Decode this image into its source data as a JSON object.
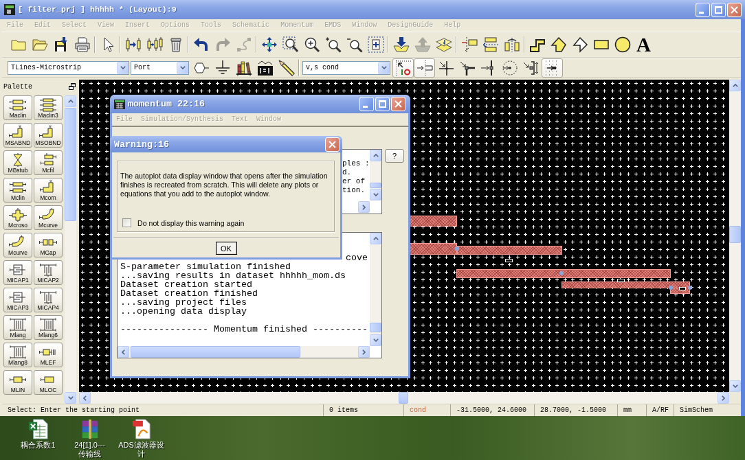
{
  "window": {
    "title": "[ filter_prj ] hhhhh * (Layout):9"
  },
  "menu": {
    "disabled": true,
    "items": [
      "File",
      "Edit",
      "Select",
      "View",
      "Insert",
      "Options",
      "Tools",
      "Schematic",
      "Momentum",
      "EMDS",
      "Window",
      "DesignGuide",
      "Help"
    ]
  },
  "main_toolbar": {
    "groups": [
      [
        {
          "kind": "new",
          "disabled": false
        },
        {
          "kind": "open",
          "disabled": false
        },
        {
          "kind": "save",
          "disabled": false
        },
        {
          "kind": "print",
          "disabled": false
        }
      ],
      [
        {
          "kind": "pointer",
          "disabled": false
        }
      ],
      [
        {
          "kind": "pinsright",
          "disabled": false
        },
        {
          "kind": "pinsleft",
          "disabled": false
        },
        {
          "kind": "trash",
          "disabled": false
        }
      ],
      [
        {
          "kind": "undo",
          "disabled": false
        },
        {
          "kind": "redo",
          "disabled": true
        },
        {
          "kind": "route",
          "disabled": true
        }
      ],
      [
        {
          "kind": "move",
          "disabled": false
        },
        {
          "kind": "zoomarea",
          "disabled": false
        },
        {
          "kind": "zoom",
          "disabled": false
        },
        {
          "kind": "zoomin",
          "disabled": false
        },
        {
          "kind": "zoomout",
          "disabled": false
        },
        {
          "kind": "fit",
          "disabled": false
        }
      ],
      [
        {
          "kind": "download",
          "disabled": false
        },
        {
          "kind": "upload",
          "disabled": true
        },
        {
          "kind": "layers",
          "disabled": false
        }
      ],
      [
        {
          "kind": "align",
          "disabled": false
        },
        {
          "kind": "mirror",
          "disabled": false
        },
        {
          "kind": "rotate",
          "disabled": false
        }
      ],
      [
        {
          "kind": "polyline",
          "disabled": false
        },
        {
          "kind": "polygon",
          "disabled": false
        },
        {
          "kind": "outline",
          "disabled": false
        },
        {
          "kind": "rectangle",
          "disabled": false
        },
        {
          "kind": "circle",
          "disabled": false
        },
        {
          "kind": "text",
          "disabled": false,
          "glyph": "A"
        }
      ]
    ]
  },
  "place_toolbar": {
    "library": "TLines-Microstrip",
    "component": "Port",
    "tools": [
      {
        "kind": "port"
      },
      {
        "kind": "ground"
      },
      {
        "kind": "library"
      },
      {
        "kind": "equation"
      },
      {
        "kind": "wire"
      }
    ],
    "layer": "v,s cond",
    "snap_modes": [
      {
        "kind": "gridsnap",
        "on": true
      },
      {
        "kind": "pinsnap",
        "on": true
      },
      {
        "kind": "intersection",
        "on": false
      },
      {
        "kind": "corner",
        "on": false
      },
      {
        "kind": "edge",
        "on": false
      },
      {
        "kind": "arc",
        "on": false
      },
      {
        "kind": "midpoint",
        "on": false
      },
      {
        "kind": "dotgrid",
        "on": true
      }
    ]
  },
  "palette": {
    "title": "Palette",
    "items": [
      {
        "label": "Maclin",
        "kind": "coupled"
      },
      {
        "label": "Maclin3",
        "kind": "coupled3"
      },
      {
        "label": "MSABND",
        "kind": "bend"
      },
      {
        "label": "MSOBND",
        "kind": "bend"
      },
      {
        "label": "MBstub",
        "kind": "bowtie"
      },
      {
        "label": "Mcfil",
        "kind": "offset"
      },
      {
        "label": "Mclin",
        "kind": "coupled"
      },
      {
        "label": "Mcorn",
        "kind": "corner"
      },
      {
        "label": "Mcroso",
        "kind": "cross"
      },
      {
        "label": "Mcurve",
        "kind": "curve"
      },
      {
        "label": "Mcurve",
        "kind": "curve"
      },
      {
        "label": "MGap",
        "kind": "gap"
      },
      {
        "label": "MICAP1",
        "kind": "fingers"
      },
      {
        "label": "MICAP2",
        "kind": "comb"
      },
      {
        "label": "MICAP3",
        "kind": "fingers"
      },
      {
        "label": "MICAP4",
        "kind": "comb"
      },
      {
        "label": "Mlang",
        "kind": "lange"
      },
      {
        "label": "Mlang6",
        "kind": "lange"
      },
      {
        "label": "Mlang8",
        "kind": "lange"
      },
      {
        "label": "MLEF",
        "kind": "lineend"
      },
      {
        "label": "MLIN",
        "kind": "line"
      },
      {
        "label": "MLOC",
        "kind": "open"
      }
    ]
  },
  "momentum_window": {
    "title": "momentum 22:16",
    "menu": {
      "disabled": true,
      "items": [
        "File",
        "Simulation/Synthesis",
        "Text",
        "Window"
      ]
    },
    "help_button": "?",
    "status_log": {
      "lines": [
        "ples :",
        "d.",
        "er of",
        "tion."
      ]
    },
    "message_log": {
      "line_fragment": "cove",
      "lines": [
        "S-parameter simulation finished",
        "...saving results in dataset hhhhh_mom.ds",
        "Dataset creation started",
        "Dataset creation finished",
        "...saving project files",
        "...opening data display"
      ],
      "footer": "---------------- Momentum finished ----------"
    }
  },
  "warning_dialog": {
    "title": "Warning:16",
    "message": "The autoplot data display window that opens after the simulation finishes is recreated from scratch. This will delete any plots or equations that you add to the autoplot window.",
    "checkbox": {
      "label": "Do not display this warning again",
      "checked": false
    },
    "ok_button": "OK"
  },
  "status_bar": {
    "fields": [
      {
        "text": "Select: Enter the starting point"
      },
      {
        "text": "0 items"
      },
      {
        "text": "cond",
        "color": "#c0603a"
      },
      {
        "text": "-31.5000, 24.6000"
      },
      {
        "text": "28.7000, -1.5000"
      },
      {
        "text": "mm"
      },
      {
        "text": "A/RF"
      },
      {
        "text": "SimSchem"
      }
    ]
  },
  "desktop": {
    "icons": [
      {
        "kind": "spreadsheet",
        "label_lines": [
          "耦合系数1"
        ]
      },
      {
        "kind": "archive",
        "label_lines": [
          "24[1].0---",
          "传输线"
        ]
      },
      {
        "kind": "pdf",
        "label_lines": [
          "ADS滤波器设",
          "计"
        ]
      }
    ]
  }
}
